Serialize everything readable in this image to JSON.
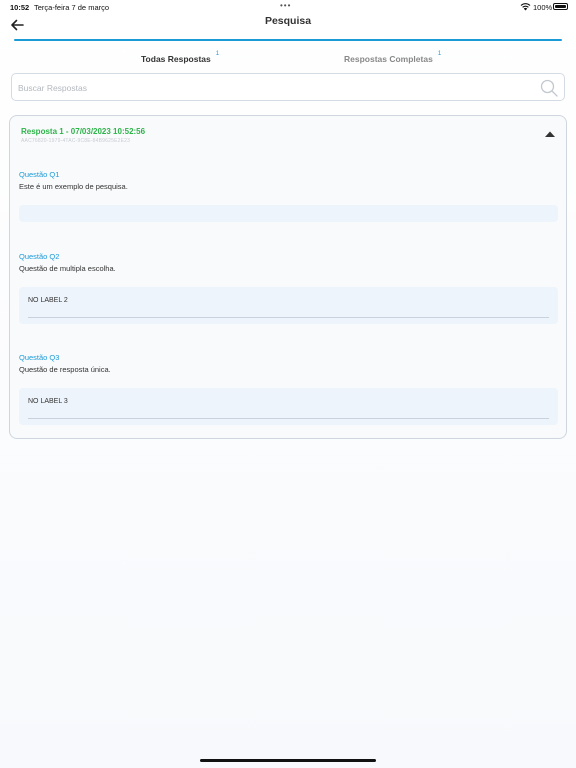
{
  "status_bar": {
    "time": "10:52",
    "date": "Terça-feira 7 de março",
    "battery": "100%"
  },
  "nav": {
    "title": "Pesquisa",
    "back_icon": "arrow-left-icon"
  },
  "colors": {
    "accent": "#1a9bd7",
    "response_title": "#2db449",
    "answer_background": "#eef4fb"
  },
  "tabs": [
    {
      "label": "Todas Respostas",
      "count": "1",
      "selected": true
    },
    {
      "label": "Respostas Completas",
      "count": "1",
      "selected": false
    }
  ],
  "search": {
    "placeholder": "Buscar Respostas",
    "value": "",
    "icon": "search-icon"
  },
  "response": {
    "title": "Resposta 1 -  07/03/2023 10:52:56",
    "id": "AAC76820-1979-4TAC-9C8E-84B9625E2E23",
    "expanded": true,
    "questions": [
      {
        "label": "Questão Q1",
        "text": "Este é um exemplo de pesquisa.",
        "answer": ""
      },
      {
        "label": "Questão Q2",
        "text": "Questão de multipla escolha.",
        "answer": "NO LABEL 2"
      },
      {
        "label": "Questão Q3",
        "text": "Questão de resposta única.",
        "answer": "NO LABEL 3"
      }
    ]
  }
}
